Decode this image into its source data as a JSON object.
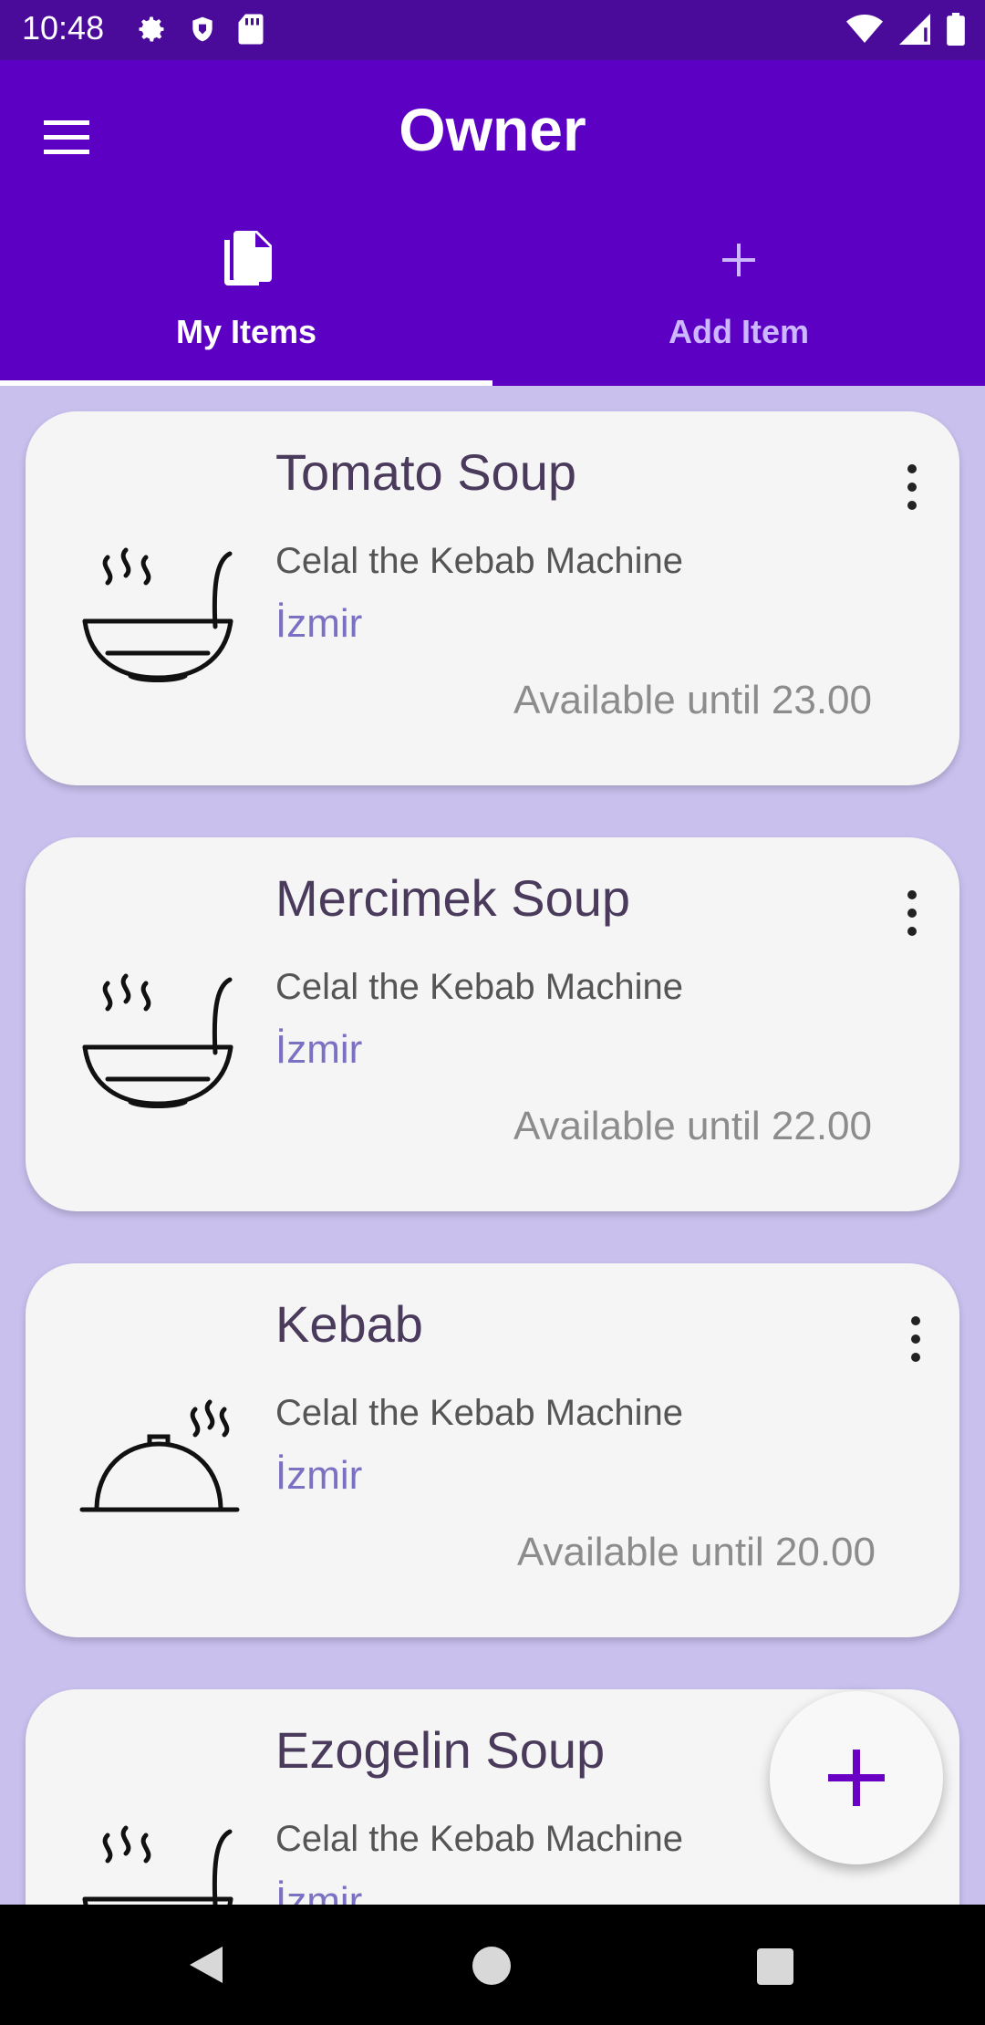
{
  "status_bar": {
    "time": "10:48",
    "left_icons": [
      "gear-icon",
      "shield-icon",
      "sd-card-icon"
    ],
    "right_icons": [
      "wifi-icon",
      "signal-icon",
      "battery-icon"
    ]
  },
  "app_bar": {
    "title": "Owner",
    "menu_icon": "menu-icon",
    "background": "#5c00c4"
  },
  "tabs": [
    {
      "label": "My Items",
      "icon": "documents-icon",
      "selected": true
    },
    {
      "label": "Add Item",
      "icon": "plus-icon",
      "selected": false
    }
  ],
  "items": [
    {
      "name": "Tomato Soup",
      "restaurant": "Celal the Kebab Machine",
      "city": "İzmir",
      "availability": "Available until 23.00",
      "icon": "soup-bowl-icon"
    },
    {
      "name": "Mercimek Soup",
      "restaurant": "Celal the Kebab Machine",
      "city": "İzmir",
      "availability": "Available until 22.00",
      "icon": "soup-bowl-icon"
    },
    {
      "name": "Kebab",
      "restaurant": "Celal the Kebab Machine",
      "city": "İzmir",
      "availability": "Available until 20.00",
      "icon": "food-cloche-icon"
    },
    {
      "name": "Ezogelin Soup",
      "restaurant": "Celal the Kebab Machine",
      "city": "İzmir",
      "availability": "",
      "icon": "soup-bowl-icon"
    }
  ],
  "fab": {
    "icon": "plus-icon",
    "color": "#6a00c4"
  },
  "colors": {
    "status_bar": "#4a0a9a",
    "list_background": "#c9c0ee",
    "card_background": "#f5f5f5",
    "city_text": "#7b71c3"
  }
}
